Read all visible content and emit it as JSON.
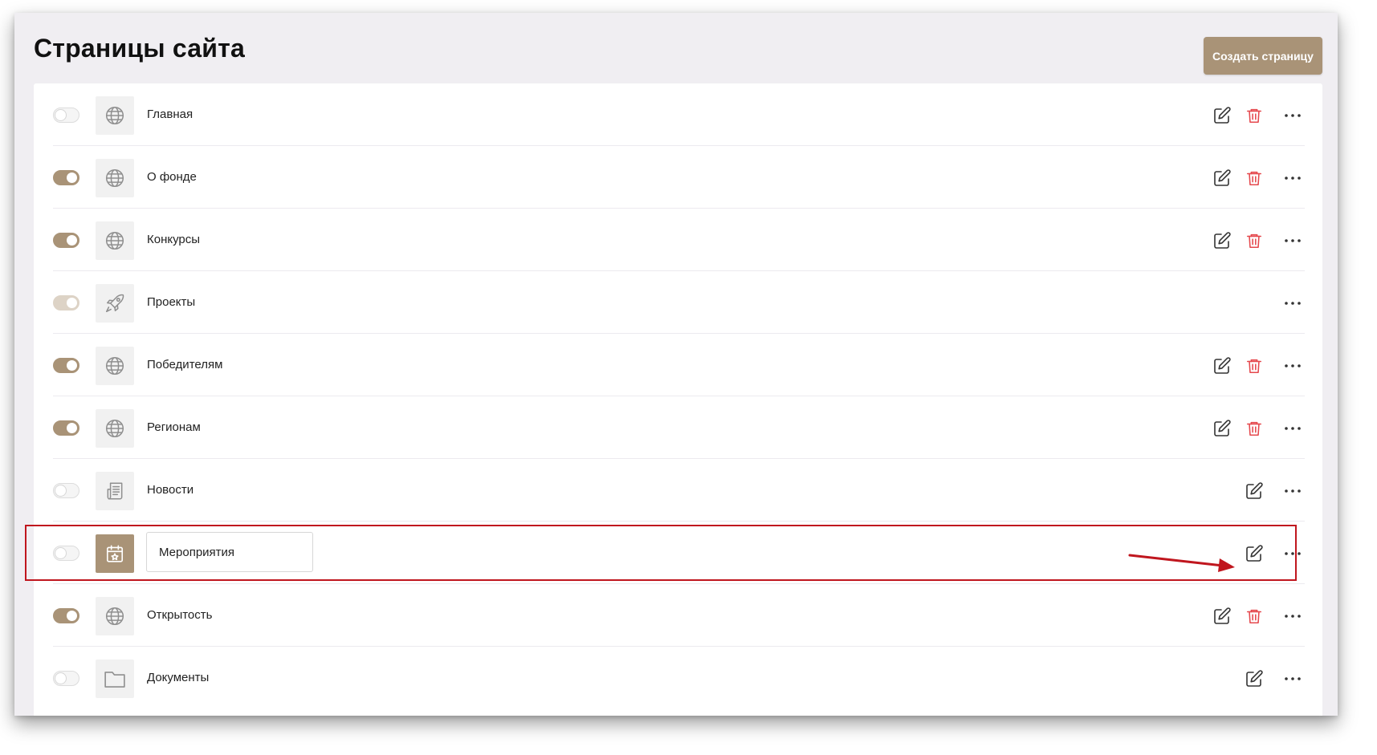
{
  "header": {
    "title": "Страницы сайта",
    "create_button_label": "Создать страницу"
  },
  "colors": {
    "accent": "#a99377",
    "delete": "#e5484d",
    "highlight_border": "#c0161e"
  },
  "pages": [
    {
      "label": "Главная",
      "toggle": "off",
      "icon": "globe-icon",
      "actions": [
        "edit",
        "delete",
        "more"
      ]
    },
    {
      "label": "О фонде",
      "toggle": "on",
      "icon": "globe-icon",
      "actions": [
        "edit",
        "delete",
        "more"
      ]
    },
    {
      "label": "Конкурсы",
      "toggle": "on",
      "icon": "globe-icon",
      "actions": [
        "edit",
        "delete",
        "more"
      ]
    },
    {
      "label": "Проекты",
      "toggle": "on-disabled",
      "icon": "rocket-icon",
      "actions": [
        "more"
      ]
    },
    {
      "label": "Победителям",
      "toggle": "on",
      "icon": "globe-icon",
      "actions": [
        "edit",
        "delete",
        "more"
      ]
    },
    {
      "label": "Регионам",
      "toggle": "on",
      "icon": "globe-icon",
      "actions": [
        "edit",
        "delete",
        "more"
      ]
    },
    {
      "label": "Новости",
      "toggle": "off",
      "icon": "news-icon",
      "actions": [
        "edit",
        "more"
      ]
    },
    {
      "label": "Мероприятия",
      "toggle": "off",
      "icon": "calendar-icon",
      "editing": true,
      "highlighted": true,
      "actions": [
        "edit",
        "more"
      ]
    },
    {
      "label": "Открытость",
      "toggle": "on",
      "icon": "globe-icon",
      "actions": [
        "edit",
        "delete",
        "more"
      ]
    },
    {
      "label": "Документы",
      "toggle": "off",
      "icon": "folder-icon",
      "actions": [
        "edit",
        "more"
      ]
    }
  ]
}
